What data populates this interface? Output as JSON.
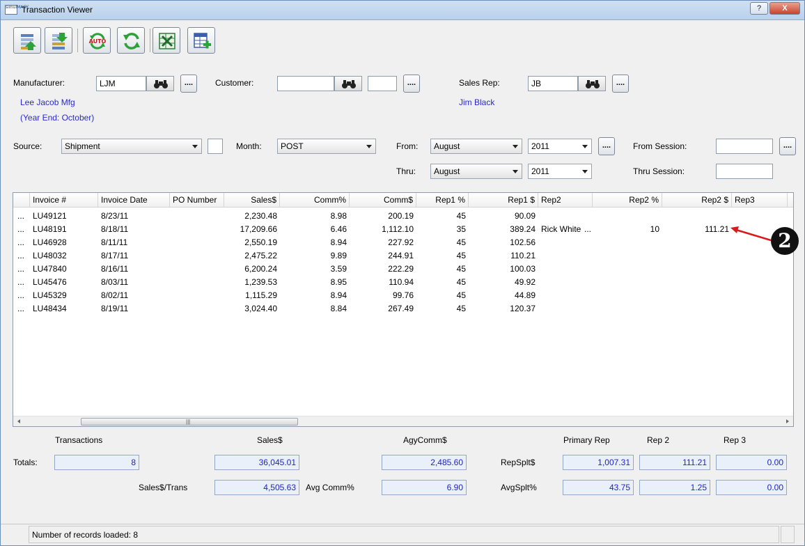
{
  "window": {
    "title": "Transaction Viewer",
    "app_icon_text": "simulMACY",
    "help_label": "?",
    "close_label": "X"
  },
  "toolbar": {
    "buttons": [
      {
        "name": "export-up-icon"
      },
      {
        "name": "import-down-icon"
      },
      {
        "name": "auto-refresh-icon",
        "text": "AUTO"
      },
      {
        "name": "refresh-icon"
      },
      {
        "name": "excel-icon"
      },
      {
        "name": "add-grid-icon"
      }
    ]
  },
  "filters": {
    "manufacturer": {
      "label": "Manufacturer:",
      "code": "LJM",
      "name": "Lee Jacob Mfg",
      "year_end": "(Year End: October)"
    },
    "customer": {
      "label": "Customer:",
      "code": "",
      "code2": ""
    },
    "sales_rep": {
      "label": "Sales Rep:",
      "code": "JB",
      "name": "Jim Black"
    },
    "browse_label": "....",
    "source": {
      "label": "Source:",
      "value": "Shipment"
    },
    "month": {
      "label": "Month:",
      "value": "POST"
    },
    "from": {
      "label": "From:",
      "month": "August",
      "year": "2011"
    },
    "thru": {
      "label": "Thru:",
      "month": "August",
      "year": "2011"
    },
    "from_session": {
      "label": "From Session:",
      "value": ""
    },
    "thru_session": {
      "label": "Thru Session:",
      "value": ""
    }
  },
  "grid": {
    "columns": [
      "Invoice #",
      "Invoice Date",
      "PO Number",
      "Sales$",
      "Comm%",
      "Comm$",
      "Rep1 %",
      "Rep1 $",
      "Rep2",
      "Rep2 %",
      "Rep2 $",
      "Rep3"
    ],
    "row_marker": "...",
    "rows": [
      {
        "invoice": "LU49121",
        "date": "8/23/11",
        "po": "",
        "sales": "2,230.48",
        "comm_pct": "8.98",
        "comm": "200.19",
        "rep1_pct": "45",
        "rep1": "90.09",
        "rep2": "",
        "rep2_dots": "",
        "rep2_pct": "",
        "rep2_amt": "",
        "rep3": ""
      },
      {
        "invoice": "LU48191",
        "date": "8/18/11",
        "po": "",
        "sales": "17,209.66",
        "comm_pct": "6.46",
        "comm": "1,112.10",
        "rep1_pct": "35",
        "rep1": "389.24",
        "rep2": "Rick White",
        "rep2_dots": "...",
        "rep2_pct": "10",
        "rep2_amt": "111.21",
        "rep3": ""
      },
      {
        "invoice": "LU46928",
        "date": "8/11/11",
        "po": "",
        "sales": "2,550.19",
        "comm_pct": "8.94",
        "comm": "227.92",
        "rep1_pct": "45",
        "rep1": "102.56",
        "rep2": "",
        "rep2_dots": "",
        "rep2_pct": "",
        "rep2_amt": "",
        "rep3": ""
      },
      {
        "invoice": "LU48032",
        "date": "8/17/11",
        "po": "",
        "sales": "2,475.22",
        "comm_pct": "9.89",
        "comm": "244.91",
        "rep1_pct": "45",
        "rep1": "110.21",
        "rep2": "",
        "rep2_dots": "",
        "rep2_pct": "",
        "rep2_amt": "",
        "rep3": ""
      },
      {
        "invoice": "LU47840",
        "date": "8/16/11",
        "po": "",
        "sales": "6,200.24",
        "comm_pct": "3.59",
        "comm": "222.29",
        "rep1_pct": "45",
        "rep1": "100.03",
        "rep2": "",
        "rep2_dots": "",
        "rep2_pct": "",
        "rep2_amt": "",
        "rep3": ""
      },
      {
        "invoice": "LU45476",
        "date": "8/03/11",
        "po": "",
        "sales": "1,239.53",
        "comm_pct": "8.95",
        "comm": "110.94",
        "rep1_pct": "45",
        "rep1": "49.92",
        "rep2": "",
        "rep2_dots": "",
        "rep2_pct": "",
        "rep2_amt": "",
        "rep3": ""
      },
      {
        "invoice": "LU45329",
        "date": "8/02/11",
        "po": "",
        "sales": "1,115.29",
        "comm_pct": "8.94",
        "comm": "99.76",
        "rep1_pct": "45",
        "rep1": "44.89",
        "rep2": "",
        "rep2_dots": "",
        "rep2_pct": "",
        "rep2_amt": "",
        "rep3": ""
      },
      {
        "invoice": "LU48434",
        "date": "8/19/11",
        "po": "",
        "sales": "3,024.40",
        "comm_pct": "8.84",
        "comm": "267.49",
        "rep1_pct": "45",
        "rep1": "120.37",
        "rep2": "",
        "rep2_dots": "",
        "rep2_pct": "",
        "rep2_amt": "",
        "rep3": ""
      }
    ],
    "scroll_grip": "|||"
  },
  "totals": {
    "headers": {
      "transactions": "Transactions",
      "sales": "Sales$",
      "agycomm": "AgyComm$",
      "primary_rep": "Primary Rep",
      "rep2": "Rep 2",
      "rep3": "Rep 3"
    },
    "totals_label": "Totals:",
    "transactions": "8",
    "sales": "36,045.01",
    "agycomm": "2,485.60",
    "repsplt_label": "RepSplt$",
    "repsplt_primary": "1,007.31",
    "repsplt_rep2": "111.21",
    "repsplt_rep3": "0.00",
    "sales_per_trans_label": "Sales$/Trans",
    "sales_per_trans": "4,505.63",
    "avg_comm_label": "Avg Comm%",
    "avg_comm": "6.90",
    "avgsplt_label": "AvgSplt%",
    "avgsplt_primary": "43.75",
    "avgsplt_rep2": "1.25",
    "avgsplt_rep3": "0.00"
  },
  "status": {
    "text": "Number of records loaded: 8"
  },
  "annotation": {
    "callout_number": "2",
    "arrow_color": "#d81c1c"
  }
}
